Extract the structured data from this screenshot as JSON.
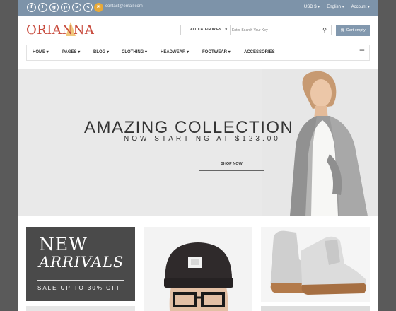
{
  "topbar": {
    "social": [
      {
        "icon": "facebook-icon",
        "glyph": "f"
      },
      {
        "icon": "twitter-icon",
        "glyph": "t"
      },
      {
        "icon": "google-plus-icon",
        "glyph": "g"
      },
      {
        "icon": "pinterest-icon",
        "glyph": "p"
      },
      {
        "icon": "vk-icon",
        "glyph": "v"
      },
      {
        "icon": "skype-icon",
        "glyph": "s"
      }
    ],
    "email": "contact@email.com",
    "currency": "USD $",
    "language": "English",
    "account": "Account"
  },
  "header": {
    "logo": "ORIANNA",
    "category_label": "ALL CATEGORIES",
    "search_placeholder": "Enter Search Your Key",
    "cart_label": "Cart empty"
  },
  "nav": {
    "items": [
      {
        "label": "HOME",
        "dropdown": true
      },
      {
        "label": "PAGES",
        "dropdown": true
      },
      {
        "label": "BLOG",
        "dropdown": true
      },
      {
        "label": "CLOTHING",
        "dropdown": true
      },
      {
        "label": "HEADWEAR",
        "dropdown": true
      },
      {
        "label": "FOOTWEAR",
        "dropdown": true
      },
      {
        "label": "ACCESSORIES",
        "dropdown": false
      }
    ]
  },
  "hero": {
    "title": "AMAZING COLLECTION",
    "subtitle": "NOW STARTING AT $123.00",
    "button": "SHOP NOW"
  },
  "banners": {
    "new_line1": "NEW",
    "new_line2": "ARRIVALS",
    "new_line3": "SALE UP TO 30% OFF"
  },
  "colors": {
    "topbar": "#7d93a9",
    "logo": "#c84a3c",
    "accent": "#e8a938",
    "cart": "#8298ae"
  }
}
